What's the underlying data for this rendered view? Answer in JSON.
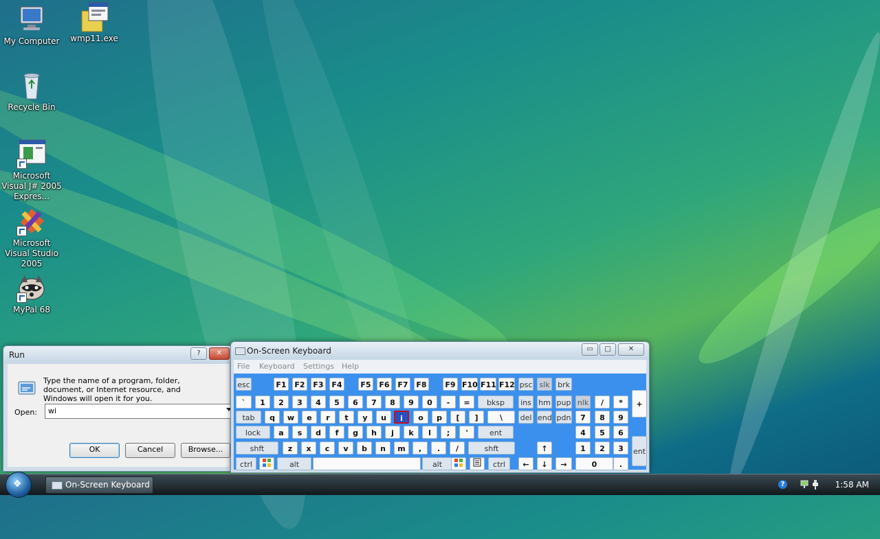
{
  "desktop": {
    "icons": [
      {
        "label": "My Computer"
      },
      {
        "label": "wmp11.exe"
      },
      {
        "label": "Recycle Bin"
      },
      {
        "label": "Microsoft Visual J# 2005 Expres..."
      },
      {
        "label": "Microsoft Visual Studio 2005"
      },
      {
        "label": "MyPal 68"
      }
    ]
  },
  "run_dialog": {
    "title": "Run",
    "description": "Type the name of a program, folder, document, or Internet resource, and Windows will open it for you.",
    "open_label": "Open:",
    "open_value": "wi",
    "ok_label": "OK",
    "cancel_label": "Cancel",
    "browse_label": "Browse...",
    "help_glyph": "?",
    "close_glyph": "✕"
  },
  "osk": {
    "title": "On-Screen Keyboard",
    "menu": [
      "File",
      "Keyboard",
      "Settings",
      "Help"
    ],
    "minimize_glyph": "▭",
    "maximize_glyph": "□",
    "close_glyph": "✕",
    "keys": {
      "row0": [
        "esc",
        "F1",
        "F2",
        "F3",
        "F4",
        "F5",
        "F6",
        "F7",
        "F8",
        "F9",
        "F10",
        "F11",
        "F12",
        "psc",
        "slk",
        "brk"
      ],
      "row1": [
        "`",
        "1",
        "2",
        "3",
        "4",
        "5",
        "6",
        "7",
        "8",
        "9",
        "0",
        "-",
        "=",
        "bksp",
        "ins",
        "hm",
        "pup",
        "nlk",
        "/",
        "*",
        "-"
      ],
      "row2": [
        "tab",
        "q",
        "w",
        "e",
        "r",
        "t",
        "y",
        "u",
        "i",
        "o",
        "p",
        "[",
        "]",
        "\\",
        "del",
        "end",
        "pdn",
        "7",
        "8",
        "9",
        "+"
      ],
      "row3": [
        "lock",
        "a",
        "s",
        "d",
        "f",
        "g",
        "h",
        "j",
        "k",
        "l",
        ";",
        "'",
        "ent",
        "4",
        "5",
        "6"
      ],
      "row4": [
        "shft",
        "z",
        "x",
        "c",
        "v",
        "b",
        "n",
        "m",
        ",",
        ".",
        "/",
        "shft",
        "↑",
        "1",
        "2",
        "3",
        "ent"
      ],
      "row5": [
        "ctrl",
        "alt",
        "alt",
        "ctrl",
        "←",
        "↓",
        "→",
        "0",
        "."
      ]
    },
    "active_key": "i",
    "accent": "#3b90ee"
  },
  "taskbar": {
    "task_label": "On-Screen Keyboard",
    "clock": "1:58 AM",
    "help_glyph": "?"
  }
}
